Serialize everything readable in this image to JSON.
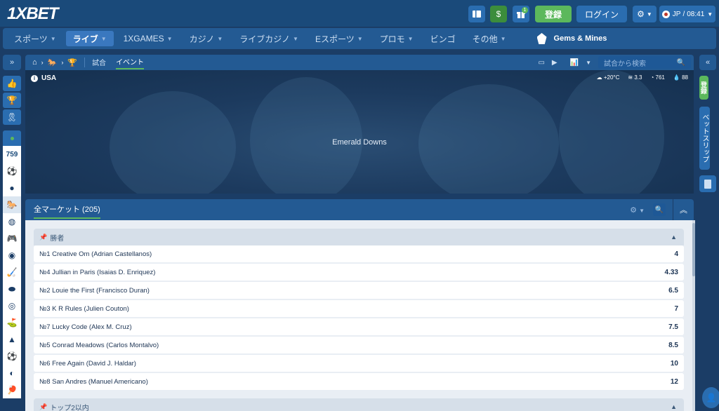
{
  "header": {
    "logo": "1XBET",
    "wallet_icon": "$",
    "gift_badge": "1",
    "register_label": "登録",
    "login_label": "ログイン",
    "lang_label": "JP",
    "time": "08:41"
  },
  "nav": {
    "items": [
      {
        "label": "スポーツ",
        "active": false,
        "dropdown": true
      },
      {
        "label": "ライブ",
        "active": true,
        "dropdown": true
      },
      {
        "label": "1XGAMES",
        "active": false,
        "dropdown": true
      },
      {
        "label": "カジノ",
        "active": false,
        "dropdown": true
      },
      {
        "label": "ライブカジノ",
        "active": false,
        "dropdown": true
      },
      {
        "label": "Eスポーツ",
        "active": false,
        "dropdown": true
      },
      {
        "label": "プロモ",
        "active": false,
        "dropdown": true
      },
      {
        "label": "ビンゴ",
        "active": false,
        "dropdown": false
      },
      {
        "label": "その他",
        "active": false,
        "dropdown": true
      }
    ],
    "promo_label": "Gems & Mines"
  },
  "sidebar": {
    "live_count": "759"
  },
  "event_bar": {
    "tabs": [
      "試合",
      "イベント"
    ],
    "active_tab": "イベント",
    "search_placeholder": "試合から検索"
  },
  "banner": {
    "country": "USA",
    "event_name": "Emerald Downs",
    "weather": {
      "temperature": "+20°C",
      "wind": "3.3",
      "pressure": "761",
      "humidity": "88"
    }
  },
  "markets": {
    "title": "全マーケット (205)",
    "groups": [
      {
        "title": "勝者",
        "rows": [
          {
            "name": "№1 Creative Om (Adrian Castellanos)",
            "odds": "4"
          },
          {
            "name": "№4 Jullian in Paris (Isaias D. Enriquez)",
            "odds": "4.33"
          },
          {
            "name": "№2 Louie the First (Francisco Duran)",
            "odds": "6.5"
          },
          {
            "name": "№3 K R Rules (Julien Couton)",
            "odds": "7"
          },
          {
            "name": "№7 Lucky Code (Alex M. Cruz)",
            "odds": "7.5"
          },
          {
            "name": "№5 Conrad Meadows (Carlos Montalvo)",
            "odds": "8.5"
          },
          {
            "name": "№6 Free Again (David J. Haldar)",
            "odds": "10"
          },
          {
            "name": "№8 San Andres (Manuel Americano)",
            "odds": "12"
          }
        ]
      },
      {
        "title": "トップ2以内",
        "rows": []
      }
    ]
  },
  "right_sidebar": {
    "register_label": "登録",
    "betslip_label": "ベットスリップ"
  }
}
